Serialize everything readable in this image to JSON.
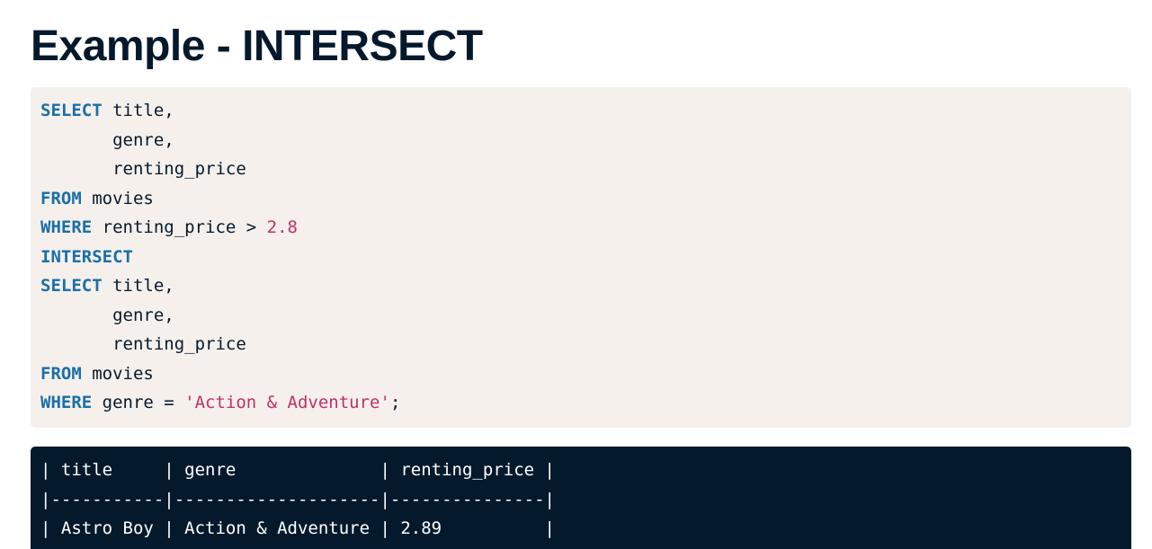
{
  "heading": "Example - INTERSECT",
  "code": {
    "l1_kw": "SELECT",
    "l1_rest": " title,",
    "l2": "       genre,",
    "l3": "       renting_price",
    "l4_kw": "FROM",
    "l4_rest": " movies",
    "l5_kw": "WHERE",
    "l5_rest": " renting_price > ",
    "l5_num": "2.8",
    "l6_kw": "INTERSECT",
    "l7_kw": "SELECT",
    "l7_rest": " title,",
    "l8": "       genre,",
    "l9": "       renting_price",
    "l10_kw": "FROM",
    "l10_rest": " movies",
    "l11_kw": "WHERE",
    "l11_rest": " genre = ",
    "l11_str": "'Action & Adventure'",
    "l11_end": ";"
  },
  "output": {
    "lines": [
      "| title     | genre              | renting_price |",
      "|-----------|--------------------|---------------|",
      "| Astro Boy | Action & Adventure | 2.89          |"
    ]
  },
  "colors": {
    "keyword": "#1a6fa8",
    "literal": "#c0306a",
    "code_bg": "#f5f0eb",
    "output_bg": "#05192d",
    "heading": "#05192d"
  }
}
